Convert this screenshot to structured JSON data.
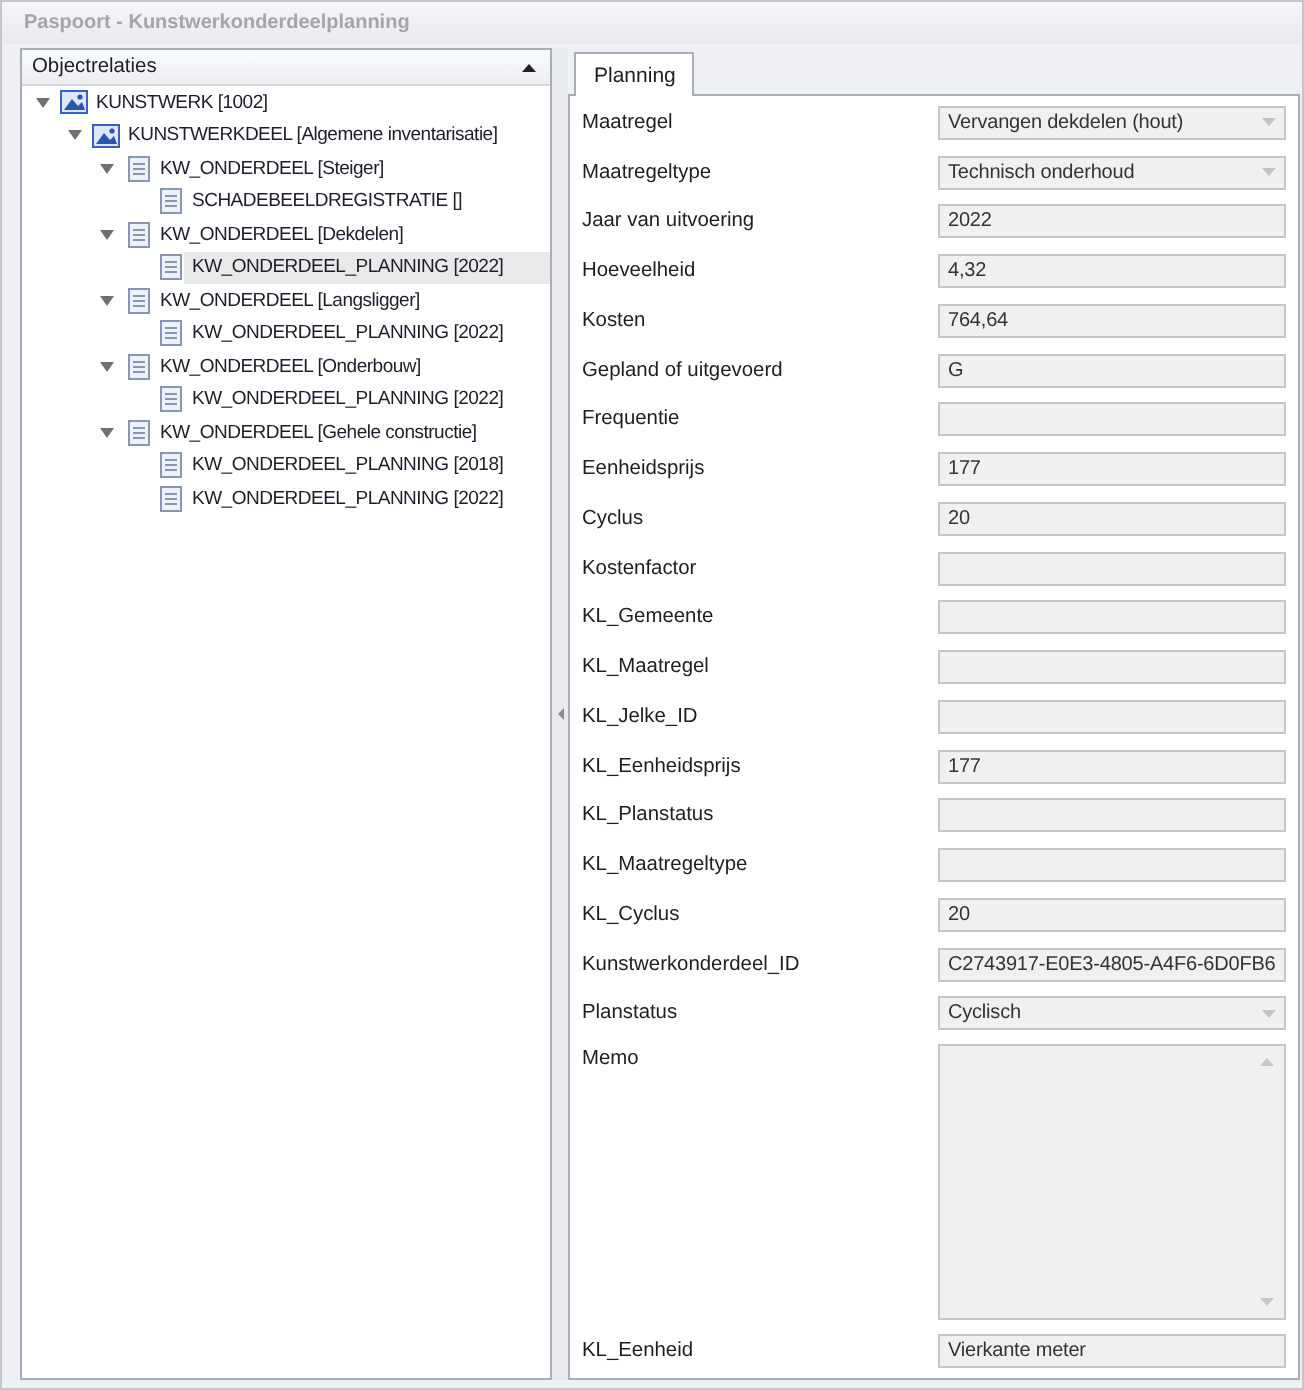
{
  "window": {
    "title": "Paspoort - Kunstwerkonderdeelplanning"
  },
  "object_panel": {
    "title": "Objectrelaties",
    "tree": [
      {
        "label": "KUNSTWERK [1002]",
        "kind": "structure",
        "expanded": true,
        "selected": false,
        "children": [
          {
            "label": "KUNSTWERKDEEL [Algemene inventarisatie]",
            "kind": "structure",
            "expanded": true,
            "selected": false,
            "children": [
              {
                "label": "KW_ONDERDEEL [Steiger]",
                "kind": "document",
                "expanded": true,
                "selected": false,
                "children": [
                  {
                    "label": "SCHADEBEELDREGISTRATIE []",
                    "kind": "document",
                    "selected": false
                  }
                ]
              },
              {
                "label": "KW_ONDERDEEL [Dekdelen]",
                "kind": "document",
                "expanded": true,
                "selected": false,
                "children": [
                  {
                    "label": "KW_ONDERDEEL_PLANNING [2022]",
                    "kind": "document",
                    "selected": true
                  }
                ]
              },
              {
                "label": "KW_ONDERDEEL [Langsligger]",
                "kind": "document",
                "expanded": true,
                "selected": false,
                "children": [
                  {
                    "label": "KW_ONDERDEEL_PLANNING [2022]",
                    "kind": "document",
                    "selected": false
                  }
                ]
              },
              {
                "label": "KW_ONDERDEEL [Onderbouw]",
                "kind": "document",
                "expanded": true,
                "selected": false,
                "children": [
                  {
                    "label": "KW_ONDERDEEL_PLANNING [2022]",
                    "kind": "document",
                    "selected": false
                  }
                ]
              },
              {
                "label": "KW_ONDERDEEL [Gehele constructie]",
                "kind": "document",
                "expanded": true,
                "selected": false,
                "children": [
                  {
                    "label": "KW_ONDERDEEL_PLANNING [2018]",
                    "kind": "document",
                    "selected": false
                  },
                  {
                    "label": "KW_ONDERDEEL_PLANNING [2022]",
                    "kind": "document",
                    "selected": false
                  }
                ]
              }
            ]
          }
        ]
      }
    ]
  },
  "tabs": [
    {
      "label": "Planning",
      "selected": true
    }
  ],
  "fields": [
    {
      "label": "Maatregel",
      "kind": "dropdown",
      "value": "Vervangen dekdelen (hout)"
    },
    {
      "label": "Maatregeltype",
      "kind": "dropdown",
      "value": "Technisch onderhoud"
    },
    {
      "label": "Jaar van uitvoering",
      "kind": "text",
      "value": "2022"
    },
    {
      "label": "Hoeveelheid",
      "kind": "text",
      "value": "4,32"
    },
    {
      "label": "Kosten",
      "kind": "text",
      "value": "764,64"
    },
    {
      "label": "Gepland of uitgevoerd",
      "kind": "text",
      "value": "G"
    },
    {
      "label": "Frequentie",
      "kind": "text"
    },
    {
      "label": "Eenheidsprijs",
      "kind": "text",
      "value": "177"
    },
    {
      "label": "Cyclus",
      "kind": "text",
      "value": "20"
    },
    {
      "label": "Kostenfactor",
      "kind": "text"
    },
    {
      "label": "KL_Gemeente",
      "kind": "text"
    },
    {
      "label": "KL_Maatregel",
      "kind": "text"
    },
    {
      "label": "KL_Jelke_ID",
      "kind": "text"
    },
    {
      "label": "KL_Eenheidsprijs",
      "kind": "text",
      "value": "177"
    },
    {
      "label": "KL_Planstatus",
      "kind": "text"
    },
    {
      "label": "KL_Maatregeltype",
      "kind": "text"
    },
    {
      "label": "KL_Cyclus",
      "kind": "text",
      "value": "20"
    },
    {
      "label": "Kunstwerkonderdeel_ID",
      "kind": "text",
      "value": "C2743917-E0E3-4805-A4F6-6D0FB6"
    },
    {
      "label": "Planstatus",
      "kind": "dropdown",
      "value": "Cyclisch"
    },
    {
      "label": "Memo",
      "kind": "memo"
    },
    {
      "label": "KL_Eenheid",
      "kind": "text",
      "value": "Vierkante meter"
    }
  ]
}
